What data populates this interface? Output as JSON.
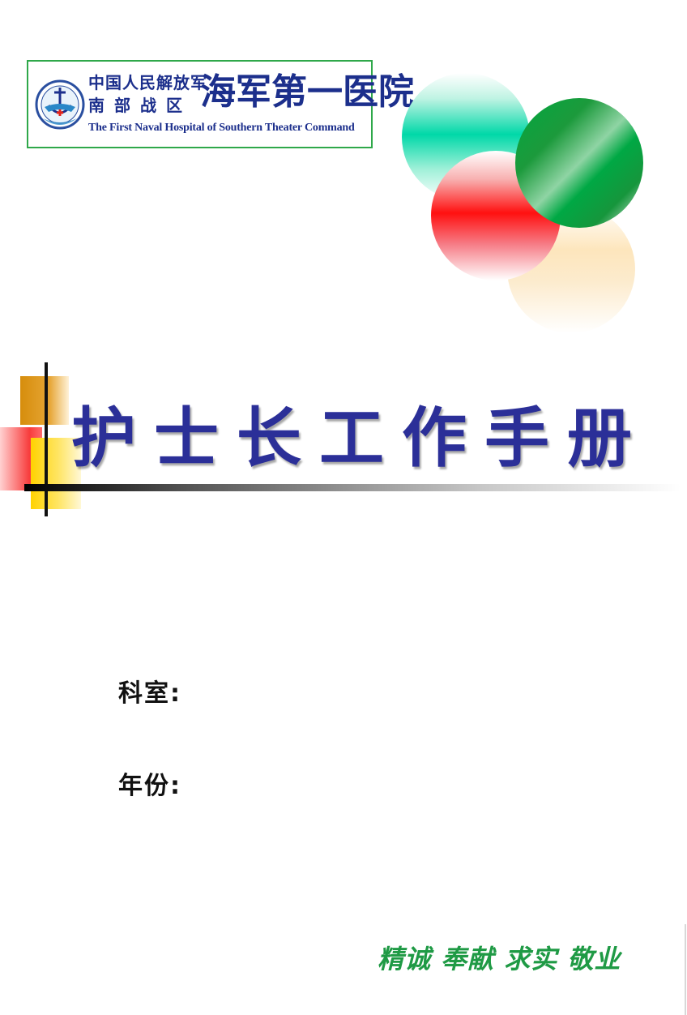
{
  "logo": {
    "line1": "中国人民解放军",
    "line2": "南部战区",
    "name": "海军第一医院",
    "english": "The First Naval Hospital of  Southern Theater Command"
  },
  "title": "护士长工作手册",
  "fields": {
    "department_label": "科室:",
    "year_label": "年份:"
  },
  "slogan": "精诚 奉献 求实 敬业",
  "colors": {
    "title": "#2b2f98",
    "logo_border": "#2fa84a",
    "slogan": "#1f9a45",
    "logo_text": "#1c2f8c"
  }
}
